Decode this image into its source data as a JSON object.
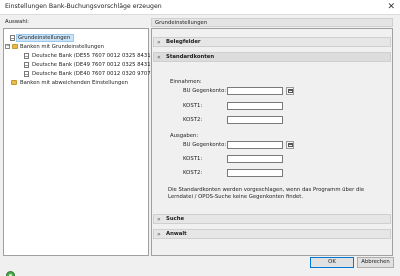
{
  "window": {
    "title": "Einstellungen Bank-Buchungsvorschläge erzeugen",
    "close_glyph": "✕"
  },
  "left": {
    "label": "Auswahl:",
    "tree": [
      {
        "label": "Grundeinstellungen",
        "icon": "document-icon",
        "selected": true
      },
      {
        "label": "Banken mit Grundeinstellungen",
        "icon": "folder-icon",
        "expander": "−"
      },
      {
        "label": "Deutsche Bank (DE55 7607 0012 0325 8431 ...",
        "icon": "document-icon"
      },
      {
        "label": "Deutsche Bank (DE49 7607 0012 0325 8431 ...",
        "icon": "document-icon"
      },
      {
        "label": "Deutsche Bank (DE40 7607 0012 0320 9707 ...",
        "icon": "document-icon"
      },
      {
        "label": "Banken mit abweichenden Einstellungen",
        "icon": "folder-icon"
      }
    ]
  },
  "right": {
    "header": "Grundeinstellungen",
    "sections": {
      "belegfelder": {
        "label": "Belegfelder",
        "chevron": "»"
      },
      "standardkonten": {
        "label": "Standardkonten",
        "chevron": "«"
      },
      "suche": {
        "label": "Suche",
        "chevron": "»"
      },
      "anwalt": {
        "label": "Anwalt",
        "chevron": "»"
      }
    },
    "einnahmen": {
      "heading": "Einnahmen:",
      "fields": [
        {
          "label": "BU Gegenkonto:",
          "value": "",
          "has_button": true
        },
        {
          "label": "KOST1:",
          "value": ""
        },
        {
          "label": "KOST2:",
          "value": ""
        }
      ]
    },
    "ausgaben": {
      "heading": "Ausgaben:",
      "fields": [
        {
          "label": "BU Gegenkonto:",
          "value": "",
          "has_button": true
        },
        {
          "label": "KOST1:",
          "value": ""
        },
        {
          "label": "KOST2:",
          "value": ""
        }
      ]
    },
    "info_text": "Die Standardkonten werden vorgeschlagen, wenn das Programm über die Lerndatei / OPOS-Suche keine Gegenkonten findet."
  },
  "footer": {
    "ok_label": "OK",
    "cancel_label": "Abbrechen"
  }
}
